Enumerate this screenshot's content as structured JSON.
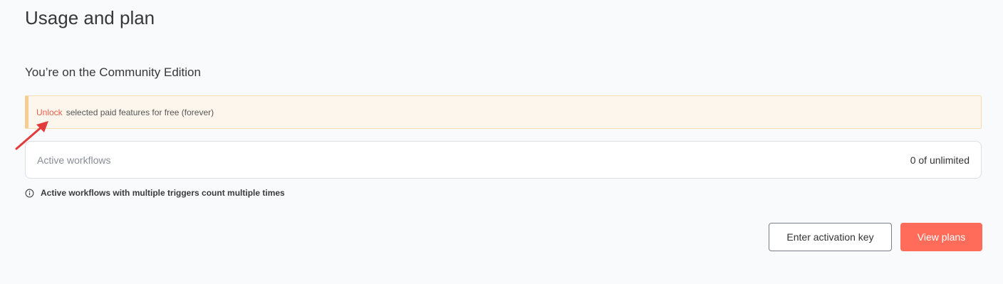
{
  "page": {
    "title": "Usage and plan"
  },
  "plan": {
    "edition_title": "You’re on the Community Edition"
  },
  "callout": {
    "link_label": "Unlock",
    "text": "selected paid features for free (forever)"
  },
  "usage": {
    "label": "Active workflows",
    "value": "0 of unlimited"
  },
  "info": {
    "icon": "info-icon",
    "text": "Active workflows with multiple triggers count multiple times"
  },
  "actions": {
    "activation_key_label": "Enter activation key",
    "view_plans_label": "View plans"
  },
  "colors": {
    "accent": "#ff6d5a",
    "link": "#ea5f4a",
    "callout_bg": "#fdf6ec",
    "annotation_arrow": "#e23b3b"
  }
}
